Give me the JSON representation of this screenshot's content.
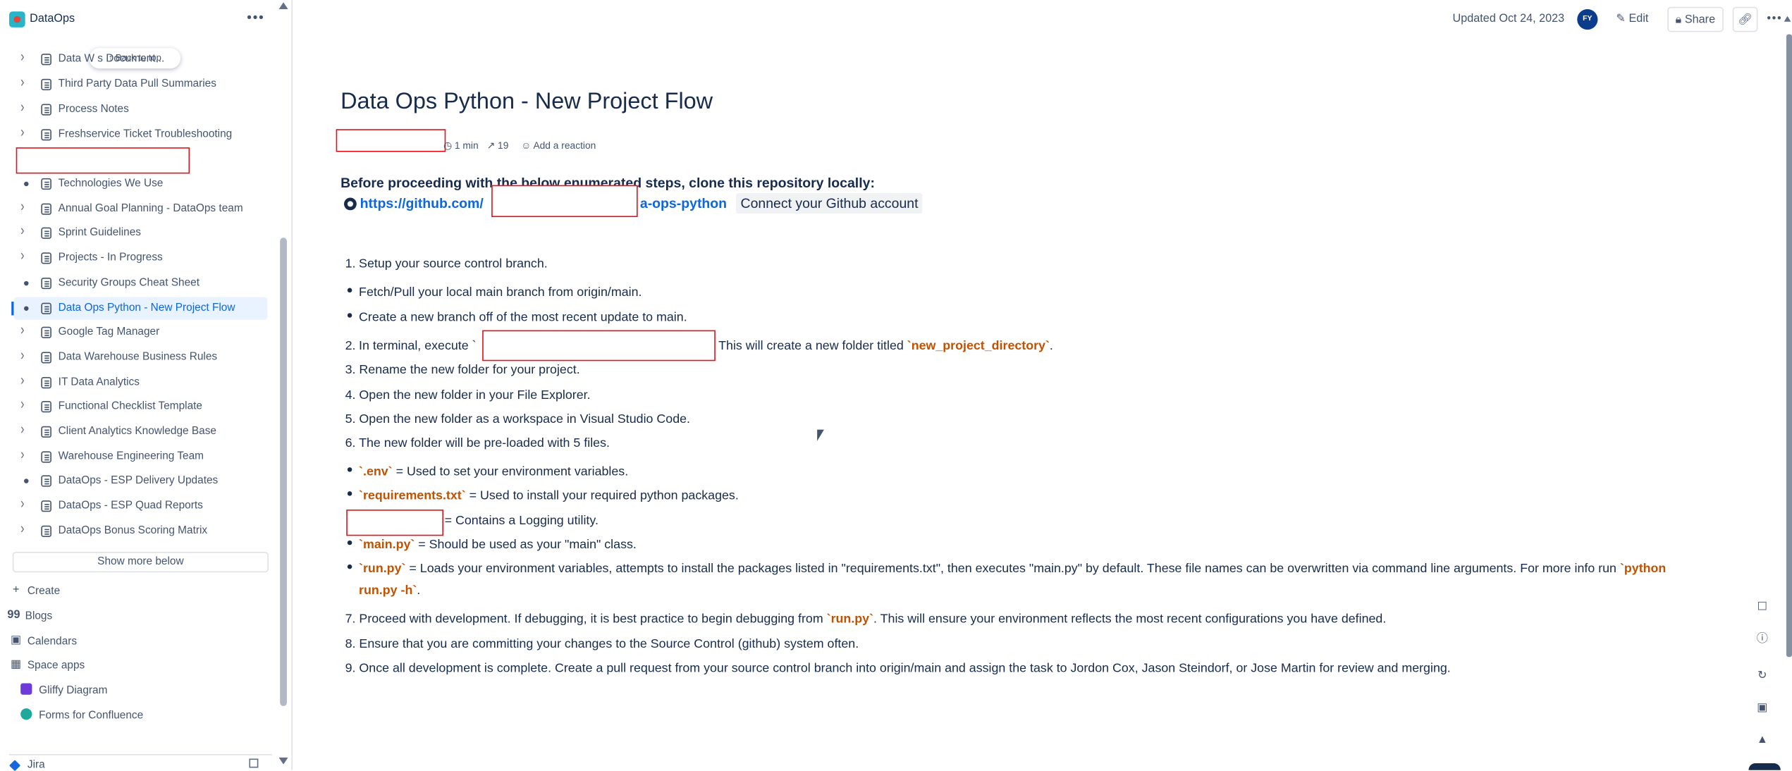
{
  "space": {
    "name": "DataOps",
    "more": "•••"
  },
  "sidebar": {
    "back_to_top": "↑ Back to top",
    "items": [
      {
        "label": "Data Warehouse Process Documents Document...",
        "shown": "Data W                  s Document...",
        "marker": "chevron"
      },
      {
        "label": "Third Party Data Pull Summaries",
        "marker": "chevron"
      },
      {
        "label": "Process Notes",
        "marker": "chevron"
      },
      {
        "label": "Freshservice Ticket Troubleshooting",
        "marker": "chevron"
      },
      {
        "label": "Technologies We Use",
        "marker": "bullet"
      },
      {
        "label": "Annual Goal Planning - DataOps team",
        "marker": "chevron"
      },
      {
        "label": "Sprint Guidelines",
        "marker": "chevron"
      },
      {
        "label": "Projects - In Progress",
        "marker": "chevron"
      },
      {
        "label": "Security Groups Cheat Sheet",
        "marker": "bullet"
      },
      {
        "label": "Data Ops Python - New Project Flow",
        "marker": "bullet",
        "active": true
      },
      {
        "label": "Google Tag Manager",
        "marker": "chevron"
      },
      {
        "label": "Data Warehouse Business Rules",
        "marker": "chevron"
      },
      {
        "label": "IT Data Analytics",
        "marker": "chevron"
      },
      {
        "label": "Functional Checklist Template",
        "marker": "chevron"
      },
      {
        "label": "Client Analytics Knowledge Base",
        "marker": "chevron"
      },
      {
        "label": "Warehouse Engineering Team",
        "marker": "chevron"
      },
      {
        "label": "DataOps - ESP Delivery Updates",
        "marker": "bullet"
      },
      {
        "label": "DataOps - ESP Quad Reports",
        "marker": "chevron"
      },
      {
        "label": "DataOps Bonus Scoring Matrix",
        "marker": "chevron"
      }
    ],
    "show_more": "Show more below",
    "nav": [
      {
        "label": "Create",
        "icon": "plus-icon"
      },
      {
        "label": "Blogs",
        "icon": "quote-icon"
      },
      {
        "label": "Calendars",
        "icon": "calendar-icon"
      },
      {
        "label": "Space apps",
        "icon": "apps-grid-icon"
      },
      {
        "label": "Gliffy Diagram",
        "icon": "gliffy-icon"
      },
      {
        "label": "Forms for Confluence",
        "icon": "forms-icon"
      }
    ],
    "jira": "Jira"
  },
  "topbar": {
    "updated": "Updated Oct 24, 2023",
    "avatar": "FY",
    "edit": "Edit",
    "share": "Share",
    "more": "•••"
  },
  "page": {
    "title": "Data Ops Python - New Project Flow",
    "read_time": "1 min",
    "views": "19",
    "reaction": "Add a reaction",
    "intro": "Before proceeding with the below enumerated steps, clone this repository locally:",
    "repo_prefix": "https://github.com/",
    "repo_suffix": "a-ops-python",
    "connect": "Connect your Github account",
    "steps": {
      "s1": "1.",
      "s1_text": "Setup your source control branch.",
      "b1": "Fetch/Pull your local main branch from origin/main.",
      "b2": "Create a new branch off of the most recent update to main.",
      "s2": "2.",
      "s2_pre": "In terminal, execute `",
      "s2_post": ". This will create a new folder titled ",
      "s2_code": "`new_project_directory`",
      "s2_end": ".",
      "s3": "3. Rename the new folder for your project.",
      "s4": "4. Open the new folder in your File Explorer.",
      "s5": "5. Open the new folder as a workspace in Visual Studio Code.",
      "s6": "6. The new folder will be pre-loaded with 5 files.",
      "f1_code": "`.env`",
      "f1_text": " = Used to set your environment variables.",
      "f2_code": "`requirements.txt`",
      "f2_text": " = Used to install your required python packages.",
      "f3_text": "= Contains a Logging utility.",
      "f4_code": "`main.py`",
      "f4_text": " = Should be used as your \"main\" class.",
      "f5_code": "`run.py`",
      "f5_text": " = Loads your environment variables, attempts to install the packages listed in \"requirements.txt\", then executes \"main.py\" by default. These file names can be overwritten via command line arguments. For more info run ",
      "f5_code2a": "`python",
      "f5_code2b": "run.py -h`",
      "f5_end": ".",
      "s7_pre": "7. Proceed with development. If debugging, it is best practice to begin debugging from ",
      "s7_code": "`run.py`",
      "s7_post": ". This will ensure your environment reflects the most recent configurations you have defined.",
      "s8": "8. Ensure that you are committing your changes to the Source Control (github) system often.",
      "s9": "9. Once all development is complete. Create a pull request from your source control branch into origin/main and assign the task to Jordon Cox, Jason Steindorf, or Jose Martin for review and merging."
    }
  },
  "colors": {
    "accent": "#0c66e4",
    "code": "#c25100",
    "redaction": "#e2131b"
  }
}
